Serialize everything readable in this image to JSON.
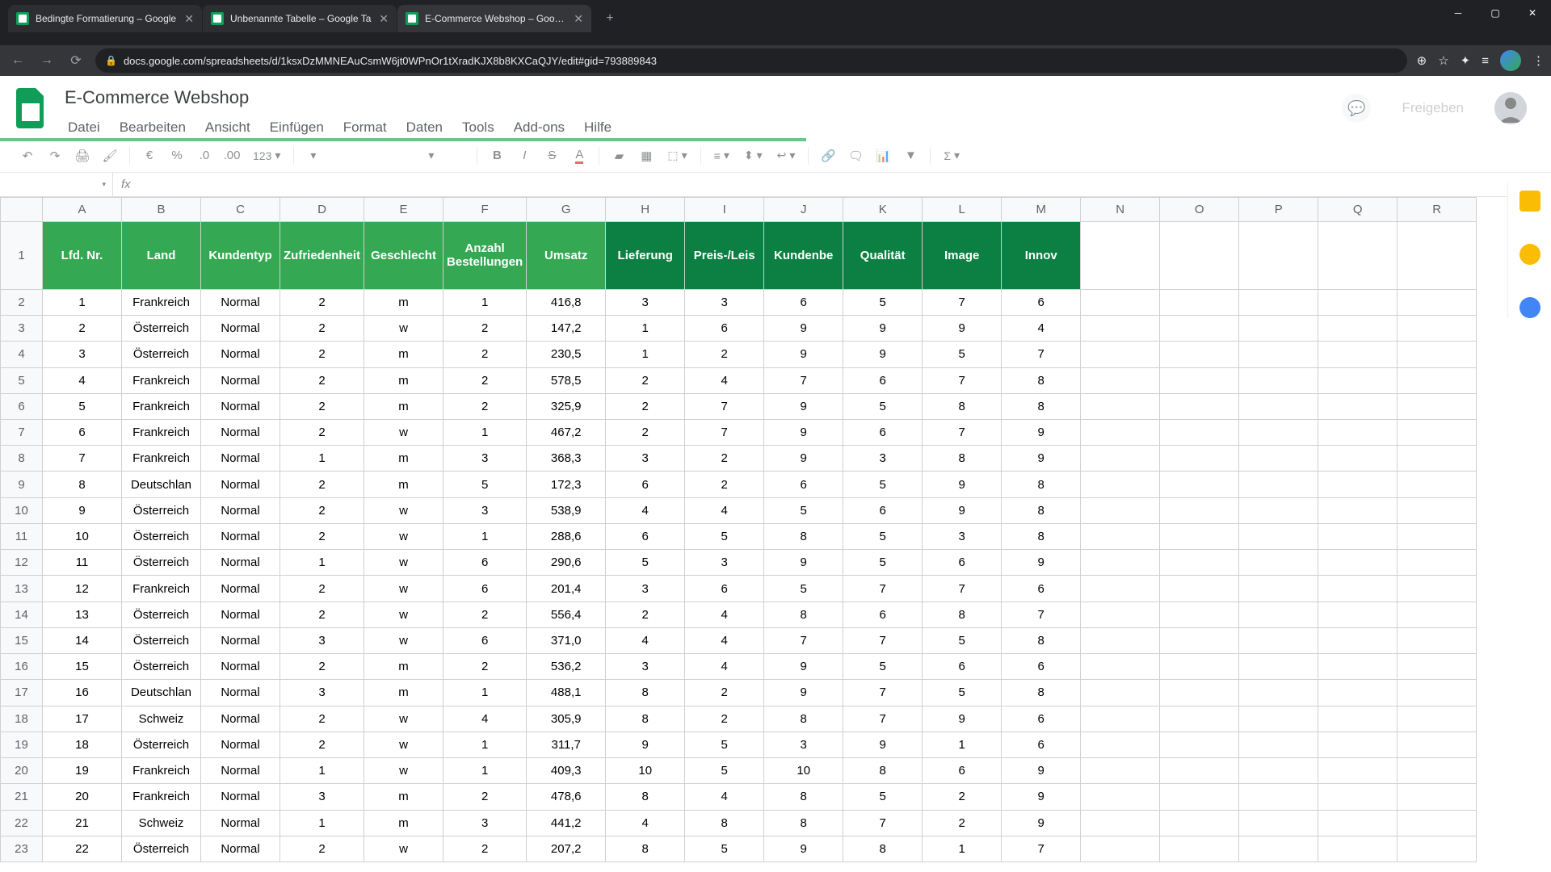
{
  "browser": {
    "tabs": [
      {
        "title": "Bedingte Formatierung – Google",
        "active": false
      },
      {
        "title": "Unbenannte Tabelle – Google Ta",
        "active": false
      },
      {
        "title": "E-Commerce Webshop – Google",
        "active": true
      }
    ],
    "url": "docs.google.com/spreadsheets/d/1ksxDzMMNEAuCsmW6jt0WPnOr1tXradKJX8b8KXCaQJY/edit#gid=793889843"
  },
  "doc": {
    "title": "E-Commerce Webshop",
    "menus": [
      "Datei",
      "Bearbeiten",
      "Ansicht",
      "Einfügen",
      "Format",
      "Daten",
      "Tools",
      "Add-ons",
      "Hilfe"
    ],
    "share_label": "Freigeben"
  },
  "toolbar": {
    "zoom": "123",
    "currency": "€",
    "percent": "%",
    "dec_minus": ".0",
    "dec_plus": ".00"
  },
  "columns": [
    "A",
    "B",
    "C",
    "D",
    "E",
    "F",
    "G",
    "H",
    "I",
    "J",
    "K",
    "L",
    "M",
    "N",
    "O",
    "P",
    "Q",
    "R"
  ],
  "headers": {
    "A": "Lfd. Nr.",
    "B": "Land",
    "C": "Kundentyp",
    "D": "Zufriedenheit",
    "E": "Geschlecht",
    "F": "Anzahl Bestellungen",
    "G": "Umsatz",
    "H": "Lieferung",
    "I": "Preis-/Leis",
    "J": "Kundenbe",
    "K": "Qualität",
    "L": "Image",
    "M": "Innov"
  },
  "dark_cols": [
    "H",
    "I",
    "J",
    "K",
    "L",
    "M"
  ],
  "chart_data": {
    "type": "table",
    "rows": [
      {
        "n": 1,
        "land": "Frankreich",
        "typ": "Normal",
        "zuf": 2,
        "g": "m",
        "anz": 1,
        "ums": "416,8",
        "lie": 3,
        "pl": 3,
        "kb": 6,
        "q": 5,
        "img": 7,
        "inn": 6
      },
      {
        "n": 2,
        "land": "Österreich",
        "typ": "Normal",
        "zuf": 2,
        "g": "w",
        "anz": 2,
        "ums": "147,2",
        "lie": 1,
        "pl": 6,
        "kb": 9,
        "q": 9,
        "img": 9,
        "inn": 4
      },
      {
        "n": 3,
        "land": "Österreich",
        "typ": "Normal",
        "zuf": 2,
        "g": "m",
        "anz": 2,
        "ums": "230,5",
        "lie": 1,
        "pl": 2,
        "kb": 9,
        "q": 9,
        "img": 5,
        "inn": 7
      },
      {
        "n": 4,
        "land": "Frankreich",
        "typ": "Normal",
        "zuf": 2,
        "g": "m",
        "anz": 2,
        "ums": "578,5",
        "lie": 2,
        "pl": 4,
        "kb": 7,
        "q": 6,
        "img": 7,
        "inn": 8
      },
      {
        "n": 5,
        "land": "Frankreich",
        "typ": "Normal",
        "zuf": 2,
        "g": "m",
        "anz": 2,
        "ums": "325,9",
        "lie": 2,
        "pl": 7,
        "kb": 9,
        "q": 5,
        "img": 8,
        "inn": 8
      },
      {
        "n": 6,
        "land": "Frankreich",
        "typ": "Normal",
        "zuf": 2,
        "g": "w",
        "anz": 1,
        "ums": "467,2",
        "lie": 2,
        "pl": 7,
        "kb": 9,
        "q": 6,
        "img": 7,
        "inn": 9
      },
      {
        "n": 7,
        "land": "Frankreich",
        "typ": "Normal",
        "zuf": 1,
        "g": "m",
        "anz": 3,
        "ums": "368,3",
        "lie": 3,
        "pl": 2,
        "kb": 9,
        "q": 3,
        "img": 8,
        "inn": 9
      },
      {
        "n": 8,
        "land": "Deutschland",
        "typ": "Normal",
        "zuf": 2,
        "g": "m",
        "anz": 5,
        "ums": "172,3",
        "lie": 6,
        "pl": 2,
        "kb": 6,
        "q": 5,
        "img": 9,
        "inn": 8
      },
      {
        "n": 9,
        "land": "Österreich",
        "typ": "Normal",
        "zuf": 2,
        "g": "w",
        "anz": 3,
        "ums": "538,9",
        "lie": 4,
        "pl": 4,
        "kb": 5,
        "q": 6,
        "img": 9,
        "inn": 8
      },
      {
        "n": 10,
        "land": "Österreich",
        "typ": "Normal",
        "zuf": 2,
        "g": "w",
        "anz": 1,
        "ums": "288,6",
        "lie": 6,
        "pl": 5,
        "kb": 8,
        "q": 5,
        "img": 3,
        "inn": 8
      },
      {
        "n": 11,
        "land": "Österreich",
        "typ": "Normal",
        "zuf": 1,
        "g": "w",
        "anz": 6,
        "ums": "290,6",
        "lie": 5,
        "pl": 3,
        "kb": 9,
        "q": 5,
        "img": 6,
        "inn": 9
      },
      {
        "n": 12,
        "land": "Frankreich",
        "typ": "Normal",
        "zuf": 2,
        "g": "w",
        "anz": 6,
        "ums": "201,4",
        "lie": 3,
        "pl": 6,
        "kb": 5,
        "q": 7,
        "img": 7,
        "inn": 6
      },
      {
        "n": 13,
        "land": "Österreich",
        "typ": "Normal",
        "zuf": 2,
        "g": "w",
        "anz": 2,
        "ums": "556,4",
        "lie": 2,
        "pl": 4,
        "kb": 8,
        "q": 6,
        "img": 8,
        "inn": 7
      },
      {
        "n": 14,
        "land": "Österreich",
        "typ": "Normal",
        "zuf": 3,
        "g": "w",
        "anz": 6,
        "ums": "371,0",
        "lie": 4,
        "pl": 4,
        "kb": 7,
        "q": 7,
        "img": 5,
        "inn": 8
      },
      {
        "n": 15,
        "land": "Österreich",
        "typ": "Normal",
        "zuf": 2,
        "g": "m",
        "anz": 2,
        "ums": "536,2",
        "lie": 3,
        "pl": 4,
        "kb": 9,
        "q": 5,
        "img": 6,
        "inn": 6
      },
      {
        "n": 16,
        "land": "Deutschland",
        "typ": "Normal",
        "zuf": 3,
        "g": "m",
        "anz": 1,
        "ums": "488,1",
        "lie": 8,
        "pl": 2,
        "kb": 9,
        "q": 7,
        "img": 5,
        "inn": 8
      },
      {
        "n": 17,
        "land": "Schweiz",
        "typ": "Normal",
        "zuf": 2,
        "g": "w",
        "anz": 4,
        "ums": "305,9",
        "lie": 8,
        "pl": 2,
        "kb": 8,
        "q": 7,
        "img": 9,
        "inn": 6
      },
      {
        "n": 18,
        "land": "Österreich",
        "typ": "Normal",
        "zuf": 2,
        "g": "w",
        "anz": 1,
        "ums": "311,7",
        "lie": 9,
        "pl": 5,
        "kb": 3,
        "q": 9,
        "img": 1,
        "inn": 6
      },
      {
        "n": 19,
        "land": "Frankreich",
        "typ": "Normal",
        "zuf": 1,
        "g": "w",
        "anz": 1,
        "ums": "409,3",
        "lie": 10,
        "pl": 5,
        "kb": 10,
        "q": 8,
        "img": 6,
        "inn": 9
      },
      {
        "n": 20,
        "land": "Frankreich",
        "typ": "Normal",
        "zuf": 3,
        "g": "m",
        "anz": 2,
        "ums": "478,6",
        "lie": 8,
        "pl": 4,
        "kb": 8,
        "q": 5,
        "img": 2,
        "inn": 9
      },
      {
        "n": 21,
        "land": "Schweiz",
        "typ": "Normal",
        "zuf": 1,
        "g": "m",
        "anz": 3,
        "ums": "441,2",
        "lie": 4,
        "pl": 8,
        "kb": 8,
        "q": 7,
        "img": 2,
        "inn": 9
      },
      {
        "n": 22,
        "land": "Österreich",
        "typ": "Normal",
        "zuf": 2,
        "g": "w",
        "anz": 2,
        "ums": "207,2",
        "lie": 8,
        "pl": 5,
        "kb": 9,
        "q": 8,
        "img": 1,
        "inn": 7
      }
    ]
  }
}
